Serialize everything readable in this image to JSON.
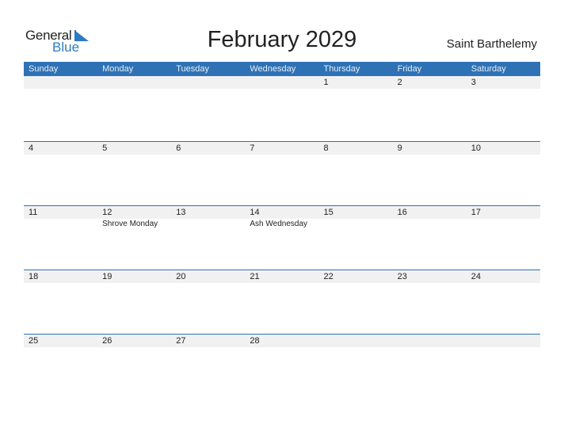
{
  "logo": {
    "word1": "General",
    "word2": "Blue",
    "icon": "triangle-flag-icon",
    "accent": "#2e7ac1"
  },
  "title": "February 2029",
  "region": "Saint Barthelemy",
  "colors": {
    "header_bg": "#2e72b5",
    "date_strip": "#f1f1f1"
  },
  "weekdays": [
    "Sunday",
    "Monday",
    "Tuesday",
    "Wednesday",
    "Thursday",
    "Friday",
    "Saturday"
  ],
  "weeks": [
    {
      "days": [
        "",
        "",
        "",
        "",
        "1",
        "2",
        "3"
      ],
      "events": [
        "",
        "",
        "",
        "",
        "",
        "",
        ""
      ]
    },
    {
      "days": [
        "4",
        "5",
        "6",
        "7",
        "8",
        "9",
        "10"
      ],
      "events": [
        "",
        "",
        "",
        "",
        "",
        "",
        ""
      ]
    },
    {
      "days": [
        "11",
        "12",
        "13",
        "14",
        "15",
        "16",
        "17"
      ],
      "events": [
        "",
        "Shrove Monday",
        "",
        "Ash Wednesday",
        "",
        "",
        ""
      ]
    },
    {
      "days": [
        "18",
        "19",
        "20",
        "21",
        "22",
        "23",
        "24"
      ],
      "events": [
        "",
        "",
        "",
        "",
        "",
        "",
        ""
      ]
    },
    {
      "days": [
        "25",
        "26",
        "27",
        "28",
        "",
        "",
        ""
      ],
      "events": [
        "",
        "",
        "",
        "",
        "",
        "",
        ""
      ]
    }
  ]
}
